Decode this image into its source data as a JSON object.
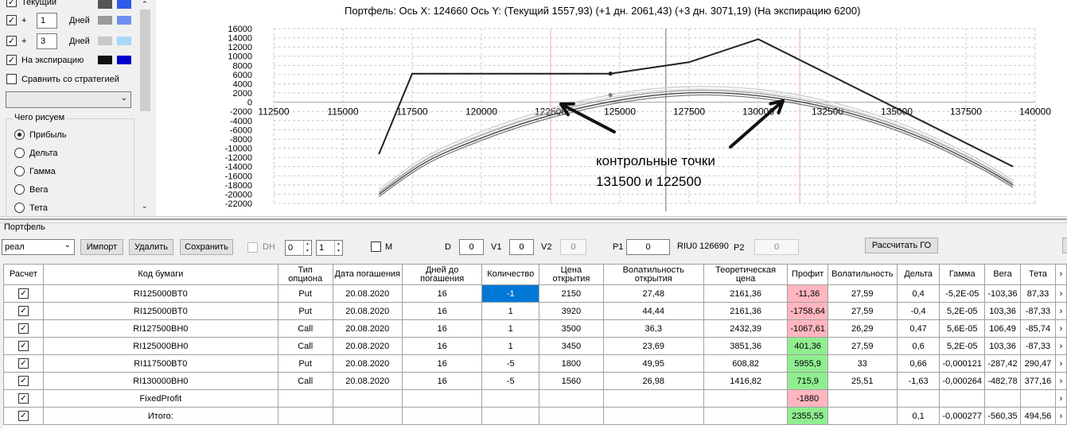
{
  "left_panel": {
    "rows": [
      {
        "label": "Текущий",
        "checked": true
      },
      {
        "label": "Дней",
        "value": "1",
        "checked": true
      },
      {
        "label": "Дней",
        "value": "3",
        "checked": true
      },
      {
        "label": "На экспирацию",
        "checked": true
      }
    ],
    "plus": "+",
    "compare_label": "Сравнить со стратегией",
    "group_title": "Чего рисуем",
    "radio_options": [
      "Прибыль",
      "Дельта",
      "Гамма",
      "Вега",
      "Тета"
    ],
    "selected_radio": "Прибыль",
    "colors": {
      "current": [
        "#555555",
        "#2f5bea"
      ],
      "plus1": [
        "#9a9a9a",
        "#6f8ff0"
      ],
      "plus3": [
        "#c8c8c8",
        "#a8d8f8"
      ],
      "expiry": [
        "#111111",
        "#0000cc"
      ]
    }
  },
  "chart": {
    "title": "Портфель: Ось X: 124660 Ось Y:  (Текущий 1557,93)  (+1 дн. 2061,43)  (+3 дн. 3071,19)  (На экспирацию 6200)",
    "annotation_line1": "контрольные точки",
    "annotation_line2": "131500 и 122500",
    "y_ticks": [
      "16000",
      "14000",
      "12000",
      "10000",
      "8000",
      "6000",
      "4000",
      "2000",
      "0",
      "-2000",
      "-4000",
      "-6000",
      "-8000",
      "-10000",
      "-12000",
      "-14000",
      "-16000",
      "-18000",
      "-20000",
      "-22000"
    ],
    "x_ticks": [
      "112500",
      "115000",
      "117500",
      "120000",
      "122500",
      "125000",
      "127500",
      "130000",
      "132500",
      "135000",
      "137500",
      "140000"
    ]
  },
  "chart_data": {
    "type": "line",
    "title": "Портфель: Ось X: 124660 Ось Y:  (Текущий 1557,93)  (+1 дн. 2061,43)  (+3 дн. 3071,19)  (На экспирацию 6200)",
    "xlim": [
      112500,
      140000
    ],
    "ylim": [
      -22000,
      16000
    ],
    "grid": true,
    "cursor_x": 126660,
    "markers_x": [
      122500,
      131500
    ],
    "series": [
      {
        "name": "На экспирацию",
        "color": "#222222",
        "width": 2,
        "x": [
          116300,
          117500,
          124660,
          127500,
          130000,
          139200
        ],
        "y": [
          -11300,
          6200,
          6200,
          8700,
          13700,
          -14000
        ]
      },
      {
        "name": "Текущий",
        "color": "#444444",
        "width": 1.3,
        "x": [
          116300,
          118000,
          120000,
          122000,
          124000,
          126000,
          128000,
          130000,
          132000,
          134000,
          136000,
          138000,
          139200
        ],
        "y": [
          -20000,
          -13000,
          -7800,
          -3700,
          -700,
          1300,
          2100,
          1400,
          -500,
          -3600,
          -8000,
          -13800,
          -18000
        ]
      },
      {
        "name": "+1 дн.",
        "color": "#999999",
        "width": 1.2,
        "x": [
          116300,
          118000,
          120000,
          122000,
          124000,
          126000,
          128000,
          130000,
          132000,
          134000,
          136000,
          138000,
          139200
        ],
        "y": [
          -19600,
          -12500,
          -7200,
          -3100,
          -100,
          1900,
          2600,
          1900,
          0,
          -3100,
          -7500,
          -13300,
          -17600
        ]
      },
      {
        "name": "+3 дн.",
        "color": "#c8c8c8",
        "width": 1.2,
        "x": [
          116300,
          118000,
          120000,
          122000,
          124000,
          126000,
          128000,
          130000,
          132000,
          134000,
          136000,
          138000,
          139200
        ],
        "y": [
          -19000,
          -11800,
          -6400,
          -2300,
          800,
          2800,
          3400,
          2800,
          900,
          -2300,
          -6700,
          -12600,
          -17000
        ]
      }
    ]
  },
  "portfolio": {
    "group_label": "Портфель",
    "selector": "реал",
    "import_btn": "Импорт",
    "delete_btn": "Удалить",
    "save_btn": "Сохранить",
    "dh_label": "DH",
    "spin1": "0",
    "spin2": "1",
    "m_label": "M",
    "d_label": "D",
    "d_value": "0",
    "v1_label": "V1",
    "v1_value": "0",
    "v2_label": "V2",
    "v2_value": "0",
    "p1_label": "P1",
    "p1_value": "0",
    "riu_label": "RIU0 126690",
    "p2_label": "P2",
    "p2_value": "0",
    "calc_btn": "Рассчитать ГО"
  },
  "table": {
    "headers": [
      "Расчет",
      "Код бумаги",
      "Тип опциона",
      "Дата погашения",
      "Дней до погашения",
      "Количество",
      "Цена открытия",
      "Волатильность открытия",
      "Теоретическая цена",
      "Профит",
      "Волатильность",
      "Дельта",
      "Гамма",
      "Вега",
      "Тета"
    ],
    "rows": [
      [
        "✓",
        "RI125000BT0",
        "Put",
        "20.08.2020",
        "16",
        "-1",
        "2150",
        "27,48",
        "2161,36",
        "-11,36",
        "27,59",
        "0,4",
        "-5,2E-05",
        "-103,36",
        "87,33"
      ],
      [
        "✓",
        "RI125000BT0",
        "Put",
        "20.08.2020",
        "16",
        "1",
        "3920",
        "44,44",
        "2161,36",
        "-1758,64",
        "27,59",
        "-0,4",
        "5,2E-05",
        "103,36",
        "-87,33"
      ],
      [
        "✓",
        "RI127500BH0",
        "Call",
        "20.08.2020",
        "16",
        "1",
        "3500",
        "36,3",
        "2432,39",
        "-1067,61",
        "26,29",
        "0,47",
        "5,6E-05",
        "106,49",
        "-85,74"
      ],
      [
        "✓",
        "RI125000BH0",
        "Call",
        "20.08.2020",
        "16",
        "1",
        "3450",
        "23,69",
        "3851,36",
        "401,36",
        "27,59",
        "0,6",
        "5,2E-05",
        "103,36",
        "-87,33"
      ],
      [
        "✓",
        "RI117500BT0",
        "Put",
        "20.08.2020",
        "16",
        "-5",
        "1800",
        "49,95",
        "608,82",
        "5955,9",
        "33",
        "0,66",
        "-0,000121",
        "-287,42",
        "290,47"
      ],
      [
        "✓",
        "RI130000BH0",
        "Call",
        "20.08.2020",
        "16",
        "-5",
        "1560",
        "26,98",
        "1416,82",
        "715,9",
        "25,51",
        "-1,63",
        "-0,000264",
        "-482,78",
        "377,16"
      ],
      [
        "✓",
        "FixedProfit",
        "",
        "",
        "",
        "",
        "",
        "",
        "",
        "-1880",
        "",
        "",
        "",
        "",
        ""
      ],
      [
        "✓",
        "Итого:",
        "",
        "",
        "",
        "",
        "",
        "",
        "",
        "2355,55",
        "",
        "0,1",
        "-0,000277",
        "-560,35",
        "494,56"
      ]
    ],
    "profit_status": [
      "pink",
      "pink",
      "pink",
      "green",
      "green",
      "green",
      "pink",
      "green"
    ]
  }
}
